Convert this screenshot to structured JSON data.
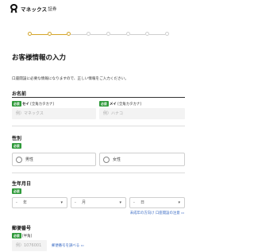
{
  "header": {
    "brand_name": "マネックス",
    "brand_sub": "証券"
  },
  "progress": {
    "total_steps": 8,
    "completed_steps": 3,
    "active_color": "#d4a52a",
    "inactive_color": "#cfcfcf"
  },
  "page": {
    "title": "お客様情報の入力",
    "intro": "口座開設に必要な情報になりますので、正しい情報をご入力ください。"
  },
  "name_section": {
    "title": "お名前",
    "required_badge": "必須",
    "sei_label": "セイ",
    "sei_note": "[全角カタカナ]",
    "sei_placeholder": "例）マネックス",
    "mei_label": "メイ",
    "mei_note": "[全角カタカナ]",
    "mei_placeholder": "例）ハナコ"
  },
  "gender_section": {
    "title": "性別",
    "required_badge": "必須",
    "male_label": "男性",
    "female_label": "女性"
  },
  "birth_section": {
    "title": "生年月日",
    "required_badge": "必須",
    "year_dash": "-",
    "year_label": "年",
    "month_dash": "-",
    "month_label": "月",
    "day_dash": "-",
    "day_label": "日",
    "caret": "▾",
    "minor_link": "未成年の方向け 口座開設の注意",
    "ext_icon": "▭"
  },
  "postal_section": {
    "title": "郵便番号",
    "required_badge": "必須",
    "note": "[半角]",
    "placeholder": "例）1076001",
    "lookup_link": "郵便番号を調べる",
    "ext_icon": "▭"
  },
  "colors": {
    "required_badge": "#2f9a3a",
    "link": "#3a6bc4"
  }
}
